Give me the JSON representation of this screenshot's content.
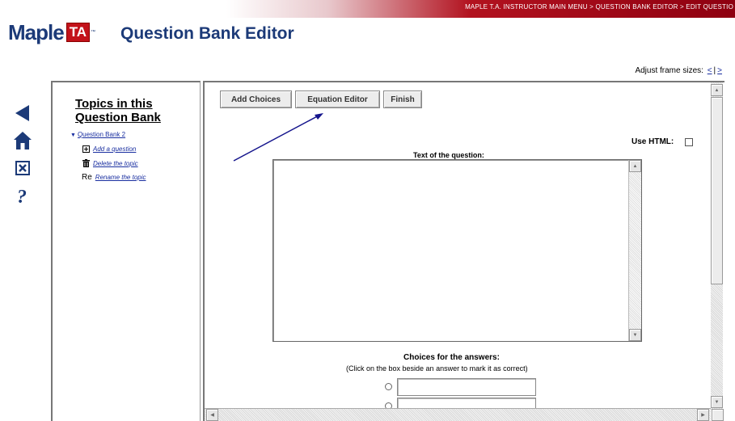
{
  "header": {
    "breadcrumb": "MAPLE T.A. INSTRUCTOR MAIN MENU > QUESTION BANK EDITOR > EDIT QUESTIO",
    "logo_text": "Maple",
    "logo_badge": "TA",
    "title": "Question Bank Editor",
    "brand_color": "#1c3a78",
    "accent_color": "#c3121a"
  },
  "frame_sizes": {
    "label": "Adjust frame sizes:",
    "shrink": "<",
    "separator": "|",
    "grow": ">"
  },
  "left_nav": {
    "icons": [
      "back-arrow-icon",
      "home-icon",
      "close-x-icon",
      "help-question-icon"
    ]
  },
  "tree": {
    "title_line1": "Topics in this",
    "title_line2": "Question Bank",
    "bank_name": "Question Bank 2",
    "items": [
      {
        "icon": "add-question-icon",
        "label": "Add a question"
      },
      {
        "icon": "trash-icon",
        "label": "Delete the topic"
      },
      {
        "icon": "rename-icon",
        "icon_text": "Re",
        "label": "Rename the topic"
      }
    ]
  },
  "editor": {
    "buttons": {
      "add_choices": "Add Choices",
      "equation_editor": "Equation Editor",
      "finish": "Finish"
    },
    "use_html_label": "Use HTML:",
    "use_html_checked": false,
    "question_label": "Text of the question:",
    "question_text": "",
    "choices_title": "Choices for the answers:",
    "choices_hint": "(Click on the box beside an answer to mark it as correct)",
    "choices": [
      "",
      ""
    ]
  },
  "annotation_color": "#14148c"
}
